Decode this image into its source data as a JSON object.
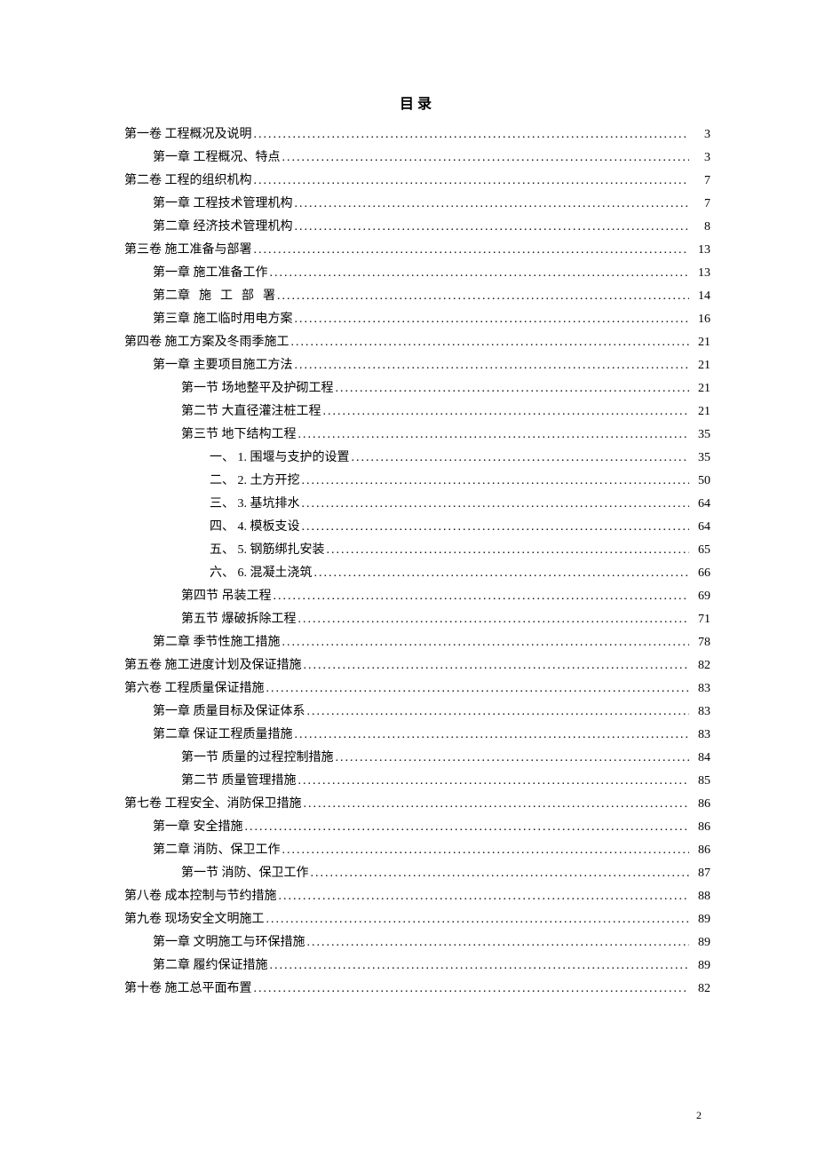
{
  "title": "目录",
  "page_number": "2",
  "toc": [
    {
      "indent": 0,
      "label": "第一卷 工程概况及说明",
      "page": "3",
      "spaced": false
    },
    {
      "indent": 1,
      "label": "第一章 工程概况、特点",
      "page": "3",
      "spaced": false
    },
    {
      "indent": 0,
      "label": "第二卷 工程的组织机构",
      "page": "7",
      "spaced": false
    },
    {
      "indent": 1,
      "label": "第一章 工程技术管理机构",
      "page": "7",
      "spaced": false
    },
    {
      "indent": 1,
      "label": "第二章 经济技术管理机构",
      "page": "8",
      "spaced": false
    },
    {
      "indent": 0,
      "label": "第三卷 施工准备与部署",
      "page": "13",
      "spaced": false
    },
    {
      "indent": 1,
      "label": "第一章 施工准备工作",
      "page": "13",
      "spaced": false
    },
    {
      "indent": 1,
      "label": "第二章 施  工  部  署",
      "page": "14",
      "spaced": true,
      "segments": [
        "第二章",
        "施",
        "工",
        "部",
        "署"
      ]
    },
    {
      "indent": 1,
      "label": "第三章 施工临时用电方案",
      "page": "16",
      "spaced": false
    },
    {
      "indent": 0,
      "label": "第四卷 施工方案及冬雨季施工",
      "page": "21",
      "spaced": false
    },
    {
      "indent": 1,
      "label": "第一章 主要项目施工方法",
      "page": "21",
      "spaced": false
    },
    {
      "indent": 2,
      "label": "第一节 场地整平及护砌工程",
      "page": "21",
      "spaced": false
    },
    {
      "indent": 2,
      "label": "第二节 大直径灌注桩工程",
      "page": "21",
      "spaced": false
    },
    {
      "indent": 2,
      "label": "第三节 地下结构工程",
      "page": "35",
      "spaced": false
    },
    {
      "indent": 3,
      "label": "一、 1. 围堰与支护的设置",
      "page": "35",
      "spaced": false
    },
    {
      "indent": 3,
      "label": "二、 2. 土方开挖",
      "page": "50",
      "spaced": false
    },
    {
      "indent": 3,
      "label": "三、 3. 基坑排水",
      "page": "64",
      "spaced": false
    },
    {
      "indent": 3,
      "label": "四、 4. 模板支设",
      "page": "64",
      "spaced": false
    },
    {
      "indent": 3,
      "label": "五、 5. 钢筋绑扎安装",
      "page": "65",
      "spaced": false
    },
    {
      "indent": 3,
      "label": "六、 6. 混凝土浇筑",
      "page": "66",
      "spaced": false
    },
    {
      "indent": 2,
      "label": "第四节 吊装工程",
      "page": "69",
      "spaced": false
    },
    {
      "indent": 2,
      "label": "第五节 爆破拆除工程",
      "page": "71",
      "spaced": false
    },
    {
      "indent": 1,
      "label": "第二章 季节性施工措施",
      "page": "78",
      "spaced": false
    },
    {
      "indent": 0,
      "label": "第五卷 施工进度计划及保证措施",
      "page": "82",
      "spaced": false
    },
    {
      "indent": 0,
      "label": "第六卷 工程质量保证措施",
      "page": "83",
      "spaced": false
    },
    {
      "indent": 1,
      "label": "第一章 质量目标及保证体系",
      "page": "83",
      "spaced": false
    },
    {
      "indent": 1,
      "label": "第二章 保证工程质量措施",
      "page": "83",
      "spaced": false
    },
    {
      "indent": 2,
      "label": "第一节 质量的过程控制措施",
      "page": "84",
      "spaced": false
    },
    {
      "indent": 2,
      "label": "第二节 质量管理措施",
      "page": "85",
      "spaced": false
    },
    {
      "indent": 0,
      "label": "第七卷 工程安全、消防保卫措施",
      "page": "86",
      "spaced": false
    },
    {
      "indent": 1,
      "label": "第一章 安全措施",
      "page": "86",
      "spaced": false
    },
    {
      "indent": 1,
      "label": "第二章 消防、保卫工作",
      "page": "86",
      "spaced": false
    },
    {
      "indent": 2,
      "label": "第一节 消防、保卫工作",
      "page": "87",
      "spaced": false
    },
    {
      "indent": 0,
      "label": "第八卷 成本控制与节约措施",
      "page": "88",
      "spaced": false
    },
    {
      "indent": 0,
      "label": "第九卷 现场安全文明施工",
      "page": "89",
      "spaced": false
    },
    {
      "indent": 1,
      "label": "第一章 文明施工与环保措施",
      "page": "89",
      "spaced": false
    },
    {
      "indent": 1,
      "label": "第二章 履约保证措施",
      "page": "89",
      "spaced": false
    },
    {
      "indent": 0,
      "label": "第十卷 施工总平面布置",
      "page": "82",
      "spaced": false
    }
  ]
}
